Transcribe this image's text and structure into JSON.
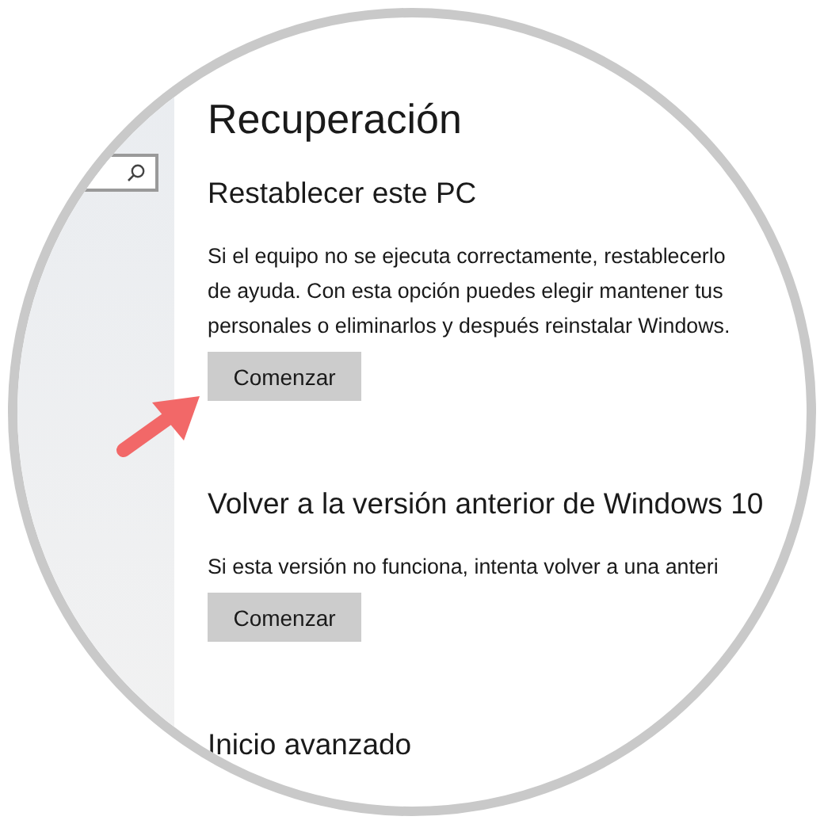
{
  "page": {
    "title": "Recuperación"
  },
  "sections": [
    {
      "heading": "Restablecer este PC",
      "lines": [
        "Si el equipo no se ejecuta correctamente, restablecerlo",
        "de ayuda. Con esta opción puedes elegir mantener tus",
        "personales o eliminarlos y después reinstalar Windows."
      ],
      "button": "Comenzar"
    },
    {
      "heading": "Volver a la versión anterior de Windows 10",
      "lines": [
        "Si esta versión no funciona, intenta volver a una anteri"
      ],
      "button": "Comenzar"
    },
    {
      "heading": "Inicio avanzado"
    }
  ]
}
